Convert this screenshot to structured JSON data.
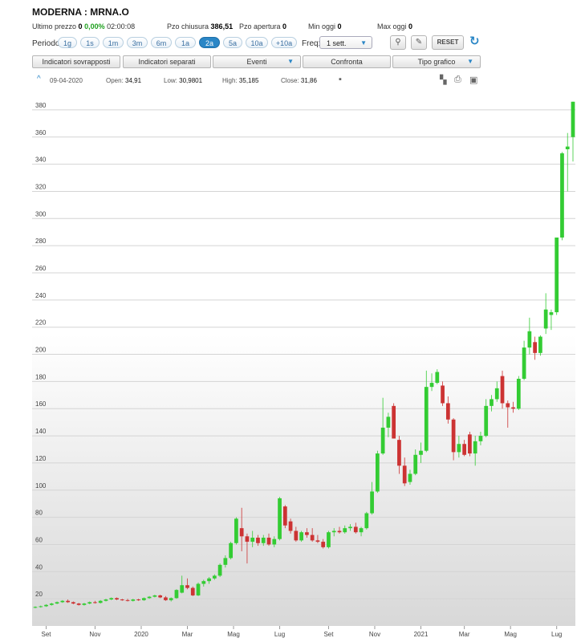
{
  "header": {
    "title": "MODERNA : MRNA.O",
    "last_price_label": "Ultimo prezzo",
    "last_price": "0",
    "change": "0,00%",
    "time": "02:00:08",
    "close_label": "Pzo chiusura",
    "close_value": "386,51",
    "open_label": "Pzo apertura",
    "open_value": "0",
    "min_label": "Min oggi",
    "min_value": "0",
    "max_label": "Max oggi",
    "max_value": "0"
  },
  "controls": {
    "period_label": "Periodo",
    "periods": [
      "1g",
      "1s",
      "1m",
      "3m",
      "6m",
      "1a",
      "2a",
      "5a",
      "10a",
      "+10a"
    ],
    "active_period": "2a",
    "freq_label": "Freq:",
    "freq_value": "1 sett.",
    "reset_label": "RESET",
    "menu_buttons": [
      "Indicatori sovrapposti",
      "Indicatori separati",
      "Eventi",
      "Confronta",
      "Tipo grafico"
    ]
  },
  "ohlc_bar": {
    "date": "09-04-2020",
    "open_label": "Open:",
    "open": "34,91",
    "low_label": "Low:",
    "low": "30,9801",
    "high_label": "High:",
    "high": "35,185",
    "close_label": "Close:",
    "close": "31,86"
  },
  "colors": {
    "up": "#33cc33",
    "down": "#cc3333",
    "accent": "#2a86c6"
  },
  "chart_data": {
    "type": "candlestick",
    "ylim": [
      0,
      390
    ],
    "yticks": [
      20,
      40,
      60,
      80,
      100,
      120,
      140,
      160,
      180,
      200,
      220,
      240,
      260,
      280,
      300,
      320,
      340,
      360,
      380
    ],
    "xticks": [
      {
        "label": "Set",
        "index": 2
      },
      {
        "label": "Nov",
        "index": 11
      },
      {
        "label": "2020",
        "index": 19.5
      },
      {
        "label": "Mar",
        "index": 28
      },
      {
        "label": "Mag",
        "index": 36.5
      },
      {
        "label": "Lug",
        "index": 45
      },
      {
        "label": "Set",
        "index": 54
      },
      {
        "label": "Nov",
        "index": 62.5
      },
      {
        "label": "2021",
        "index": 71
      },
      {
        "label": "Mar",
        "index": 79
      },
      {
        "label": "Mag",
        "index": 87.5
      },
      {
        "label": "Lug",
        "index": 96
      }
    ],
    "candles": [
      {
        "o": 13.5,
        "h": 14.5,
        "l": 13,
        "c": 14
      },
      {
        "o": 14,
        "h": 15,
        "l": 13.5,
        "c": 14.5
      },
      {
        "o": 14.5,
        "h": 16,
        "l": 14,
        "c": 15.5
      },
      {
        "o": 15.5,
        "h": 17,
        "l": 15,
        "c": 16.5
      },
      {
        "o": 16.5,
        "h": 18,
        "l": 16,
        "c": 17.5
      },
      {
        "o": 17.5,
        "h": 19,
        "l": 17,
        "c": 18.5
      },
      {
        "o": 18.5,
        "h": 19.5,
        "l": 17,
        "c": 17.5
      },
      {
        "o": 17.5,
        "h": 18,
        "l": 16,
        "c": 16.5
      },
      {
        "o": 16.5,
        "h": 17,
        "l": 15,
        "c": 15.5
      },
      {
        "o": 15.5,
        "h": 17,
        "l": 15,
        "c": 16.5
      },
      {
        "o": 16.5,
        "h": 18,
        "l": 16,
        "c": 17.5
      },
      {
        "o": 17.5,
        "h": 18.5,
        "l": 16.5,
        "c": 17
      },
      {
        "o": 17,
        "h": 19,
        "l": 16.5,
        "c": 18.5
      },
      {
        "o": 18.5,
        "h": 20,
        "l": 18,
        "c": 19.5
      },
      {
        "o": 19.5,
        "h": 21,
        "l": 19,
        "c": 20.5
      },
      {
        "o": 20.5,
        "h": 21,
        "l": 19,
        "c": 19.5
      },
      {
        "o": 19.5,
        "h": 20,
        "l": 18.5,
        "c": 19
      },
      {
        "o": 19,
        "h": 20,
        "l": 18,
        "c": 18.5
      },
      {
        "o": 18.5,
        "h": 20,
        "l": 18,
        "c": 19.5
      },
      {
        "o": 19.5,
        "h": 20,
        "l": 18.5,
        "c": 19
      },
      {
        "o": 19,
        "h": 21,
        "l": 18.5,
        "c": 20.5
      },
      {
        "o": 20.5,
        "h": 22,
        "l": 20,
        "c": 21.5
      },
      {
        "o": 21.5,
        "h": 23,
        "l": 21,
        "c": 22.5
      },
      {
        "o": 22.5,
        "h": 23,
        "l": 20.5,
        "c": 21
      },
      {
        "o": 21,
        "h": 22,
        "l": 18.5,
        "c": 19
      },
      {
        "o": 19,
        "h": 21,
        "l": 18,
        "c": 20.5
      },
      {
        "o": 20.5,
        "h": 27,
        "l": 20,
        "c": 26.5
      },
      {
        "o": 24.5,
        "h": 37,
        "l": 24,
        "c": 30
      },
      {
        "o": 30,
        "h": 35,
        "l": 27,
        "c": 28
      },
      {
        "o": 28,
        "h": 29,
        "l": 22,
        "c": 22.5
      },
      {
        "o": 22.5,
        "h": 32,
        "l": 22,
        "c": 31
      },
      {
        "o": 31,
        "h": 34,
        "l": 29,
        "c": 33
      },
      {
        "o": 33,
        "h": 36,
        "l": 31,
        "c": 35
      },
      {
        "o": 35,
        "h": 38,
        "l": 34,
        "c": 37
      },
      {
        "o": 37,
        "h": 46,
        "l": 36,
        "c": 45
      },
      {
        "o": 45,
        "h": 52,
        "l": 43,
        "c": 50
      },
      {
        "o": 50,
        "h": 62,
        "l": 49,
        "c": 61
      },
      {
        "o": 61,
        "h": 80,
        "l": 60,
        "c": 79
      },
      {
        "o": 72,
        "h": 87,
        "l": 55,
        "c": 66
      },
      {
        "o": 66,
        "h": 68,
        "l": 46,
        "c": 62
      },
      {
        "o": 62,
        "h": 70,
        "l": 58,
        "c": 65
      },
      {
        "o": 65,
        "h": 67,
        "l": 59,
        "c": 61
      },
      {
        "o": 61,
        "h": 67,
        "l": 59,
        "c": 65
      },
      {
        "o": 65,
        "h": 68,
        "l": 59,
        "c": 60
      },
      {
        "o": 60,
        "h": 66,
        "l": 58,
        "c": 64
      },
      {
        "o": 64,
        "h": 95,
        "l": 63,
        "c": 94
      },
      {
        "o": 88,
        "h": 89,
        "l": 72,
        "c": 74
      },
      {
        "o": 77,
        "h": 79,
        "l": 68,
        "c": 70
      },
      {
        "o": 70,
        "h": 73,
        "l": 62,
        "c": 63
      },
      {
        "o": 63,
        "h": 70,
        "l": 62,
        "c": 69
      },
      {
        "o": 69,
        "h": 72,
        "l": 65,
        "c": 67
      },
      {
        "o": 67,
        "h": 72,
        "l": 62,
        "c": 63
      },
      {
        "o": 63,
        "h": 67,
        "l": 61,
        "c": 62
      },
      {
        "o": 62,
        "h": 64,
        "l": 57,
        "c": 58
      },
      {
        "o": 58,
        "h": 70,
        "l": 57,
        "c": 69
      },
      {
        "o": 69,
        "h": 72,
        "l": 66,
        "c": 70
      },
      {
        "o": 70,
        "h": 73,
        "l": 68,
        "c": 69
      },
      {
        "o": 69,
        "h": 74,
        "l": 68,
        "c": 72
      },
      {
        "o": 72,
        "h": 75,
        "l": 70,
        "c": 73
      },
      {
        "o": 73,
        "h": 76,
        "l": 68,
        "c": 69
      },
      {
        "o": 69,
        "h": 73,
        "l": 66,
        "c": 72
      },
      {
        "o": 72,
        "h": 84,
        "l": 71,
        "c": 83
      },
      {
        "o": 83,
        "h": 106,
        "l": 82,
        "c": 99
      },
      {
        "o": 99,
        "h": 129,
        "l": 98,
        "c": 127
      },
      {
        "o": 127,
        "h": 168,
        "l": 126,
        "c": 146
      },
      {
        "o": 146,
        "h": 157,
        "l": 139,
        "c": 154
      },
      {
        "o": 162,
        "h": 164,
        "l": 138,
        "c": 138
      },
      {
        "o": 137,
        "h": 140,
        "l": 112,
        "c": 118
      },
      {
        "o": 118,
        "h": 124,
        "l": 103,
        "c": 105
      },
      {
        "o": 106,
        "h": 115,
        "l": 104,
        "c": 112
      },
      {
        "o": 112,
        "h": 130,
        "l": 111,
        "c": 126
      },
      {
        "o": 126,
        "h": 135,
        "l": 120,
        "c": 129
      },
      {
        "o": 129,
        "h": 188,
        "l": 128,
        "c": 176
      },
      {
        "o": 176,
        "h": 186,
        "l": 173,
        "c": 179
      },
      {
        "o": 179,
        "h": 189,
        "l": 178,
        "c": 187
      },
      {
        "o": 177,
        "h": 180,
        "l": 162,
        "c": 164
      },
      {
        "o": 164,
        "h": 169,
        "l": 149,
        "c": 152
      },
      {
        "o": 152,
        "h": 153,
        "l": 122,
        "c": 128
      },
      {
        "o": 128,
        "h": 140,
        "l": 124,
        "c": 134
      },
      {
        "o": 134,
        "h": 137,
        "l": 125,
        "c": 126
      },
      {
        "o": 141,
        "h": 143,
        "l": 125,
        "c": 127
      },
      {
        "o": 127,
        "h": 140,
        "l": 118,
        "c": 136
      },
      {
        "o": 136,
        "h": 143,
        "l": 133,
        "c": 140
      },
      {
        "o": 140,
        "h": 167,
        "l": 139,
        "c": 162
      },
      {
        "o": 162,
        "h": 170,
        "l": 158,
        "c": 167
      },
      {
        "o": 167,
        "h": 180,
        "l": 165,
        "c": 175
      },
      {
        "o": 184,
        "h": 188,
        "l": 160,
        "c": 164
      },
      {
        "o": 164,
        "h": 166,
        "l": 146,
        "c": 161
      },
      {
        "o": 161,
        "h": 165,
        "l": 157,
        "c": 160
      },
      {
        "o": 160,
        "h": 184,
        "l": 159,
        "c": 182
      },
      {
        "o": 182,
        "h": 210,
        "l": 181,
        "c": 205
      },
      {
        "o": 205,
        "h": 227,
        "l": 200,
        "c": 217
      },
      {
        "o": 209,
        "h": 213,
        "l": 196,
        "c": 201
      },
      {
        "o": 201,
        "h": 214,
        "l": 199,
        "c": 213
      },
      {
        "o": 219,
        "h": 245,
        "l": 215,
        "c": 233
      },
      {
        "o": 229,
        "h": 233,
        "l": 218,
        "c": 231
      },
      {
        "o": 231,
        "h": 283,
        "l": 229,
        "c": 286
      },
      {
        "o": 286,
        "h": 349,
        "l": 284,
        "c": 348
      },
      {
        "o": 351,
        "h": 363,
        "l": 320,
        "c": 353
      },
      {
        "o": 360,
        "h": 386,
        "l": 342,
        "c": 386
      }
    ]
  }
}
